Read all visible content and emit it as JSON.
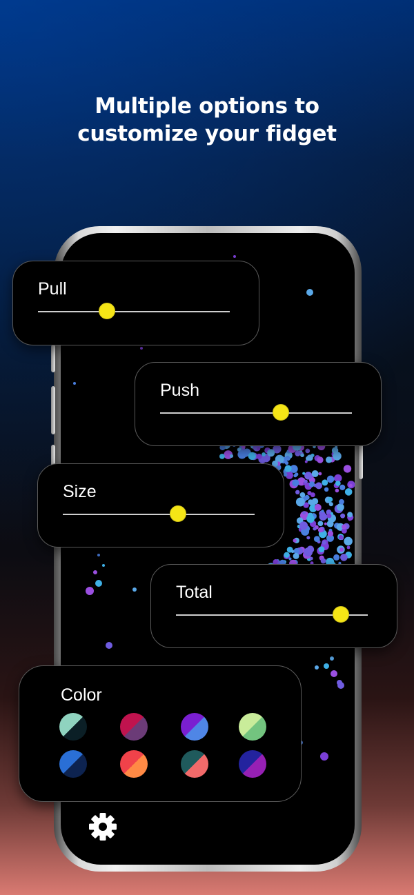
{
  "headline": {
    "line1": "Multiple options to",
    "line2": "customize your fidget"
  },
  "controls": {
    "pull": {
      "label": "Pull",
      "value": 0.36
    },
    "push": {
      "label": "Push",
      "value": 0.63
    },
    "size": {
      "label": "Size",
      "value": 0.6
    },
    "total": {
      "label": "Total",
      "value": 0.86
    }
  },
  "color_panel": {
    "label": "Color",
    "swatches": [
      {
        "name": "mint-black",
        "a": "#8fd3bf",
        "b": "#0b1f26"
      },
      {
        "name": "crimson-plum",
        "a": "#c0134e",
        "b": "#6b3b77"
      },
      {
        "name": "violet-blue",
        "a": "#7a1fd1",
        "b": "#4f86e6"
      },
      {
        "name": "lime-green",
        "a": "#c9ec9a",
        "b": "#73c47f"
      },
      {
        "name": "blue-navy",
        "a": "#2a6fd6",
        "b": "#0d2350"
      },
      {
        "name": "red-orange",
        "a": "#f0424a",
        "b": "#ff8a45"
      },
      {
        "name": "teal-coral",
        "a": "#1f5a5c",
        "b": "#f26a6a"
      },
      {
        "name": "indigo-purple",
        "a": "#23239e",
        "b": "#9620b4"
      }
    ]
  },
  "colors": {
    "slider_thumb": "#f5e516",
    "card_background": "#000000",
    "card_border": "#5a5a5a"
  },
  "icons": {
    "settings": "gear-icon"
  }
}
